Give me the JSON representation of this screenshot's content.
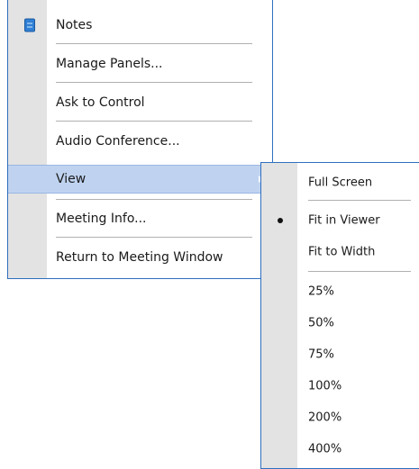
{
  "main_menu": {
    "items": [
      {
        "label": "Notes",
        "icon": "notes-icon"
      },
      {
        "label": "Manage Panels..."
      },
      {
        "label": "Ask to Control"
      },
      {
        "label": "Audio Conference..."
      },
      {
        "label": "View",
        "has_submenu": true,
        "highlighted": true
      },
      {
        "label": "Meeting Info..."
      },
      {
        "label": "Return to Meeting Window"
      }
    ]
  },
  "view_submenu": {
    "items": [
      {
        "label": "Full Screen"
      },
      {
        "label": "Fit in Viewer",
        "selected": true
      },
      {
        "label": "Fit to Width"
      },
      {
        "label": "25%"
      },
      {
        "label": "50%"
      },
      {
        "label": "75%"
      },
      {
        "label": "100%"
      },
      {
        "label": "200%"
      },
      {
        "label": "400%"
      }
    ]
  },
  "colors": {
    "menu_border": "#2e6fbf",
    "highlight": "#bfd3f0",
    "gutter": "#e3e3e3"
  }
}
